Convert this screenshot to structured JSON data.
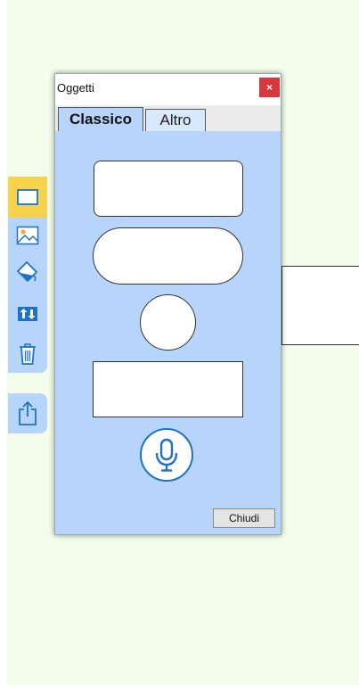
{
  "dialog": {
    "title": "Oggetti",
    "close_glyph": "×",
    "tabs": [
      {
        "label": "Classico",
        "active": true
      },
      {
        "label": "Altro",
        "active": false
      }
    ],
    "shapes": [
      {
        "kind": "rounded-rectangle"
      },
      {
        "kind": "pill"
      },
      {
        "kind": "circle"
      },
      {
        "kind": "rectangle"
      }
    ],
    "mic_icon": "microphone-icon",
    "close_button_label": "Chiudi"
  },
  "toolbar": {
    "items": [
      {
        "icon": "rectangle-icon",
        "active": true
      },
      {
        "icon": "image-icon",
        "active": false
      },
      {
        "icon": "fill-pen-icon",
        "active": false
      },
      {
        "icon": "arrange-icon",
        "active": false
      },
      {
        "icon": "trash-icon",
        "active": false
      }
    ],
    "export_icon": "share-icon"
  },
  "colors": {
    "panel": "#b7d5fb",
    "canvas": "#f4fdeb",
    "active_tool": "#f6d34b",
    "close": "#d9363e",
    "accent": "#1e73c8"
  }
}
